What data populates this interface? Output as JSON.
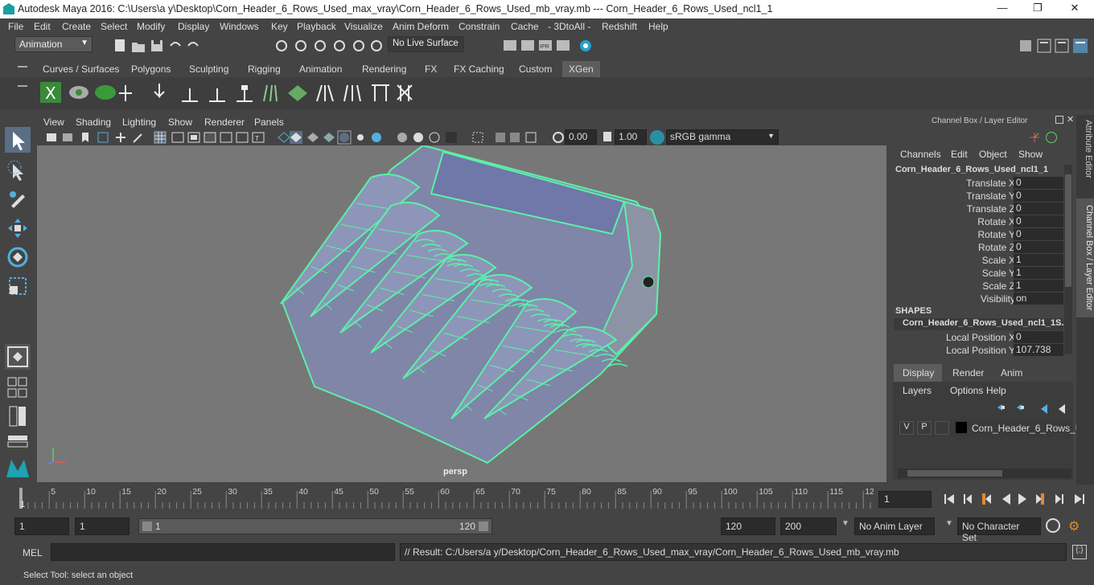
{
  "window": {
    "title": "Autodesk Maya 2016: C:\\Users\\a y\\Desktop\\Corn_Header_6_Rows_Used_max_vray\\Corn_Header_6_Rows_Used_mb_vray.mb   ---   Corn_Header_6_Rows_Used_ncl1_1",
    "minimize": "—",
    "maximize": "❐",
    "close": "✕"
  },
  "menubar": [
    "File",
    "Edit",
    "Create",
    "Select",
    "Modify",
    "Display",
    "Windows",
    "Key",
    "Playback",
    "Visualize",
    "Anim Deform",
    "Constrain",
    "Cache",
    "- 3DtoAll -",
    "Redshift",
    "Help"
  ],
  "statusline": {
    "mode_menu": "Animation",
    "live_surface": "No Live Surface"
  },
  "shelf_tabs": [
    "Curves / Surfaces",
    "Polygons",
    "Sculpting",
    "Rigging",
    "Animation",
    "Rendering",
    "FX",
    "FX Caching",
    "Custom",
    "XGen"
  ],
  "shelf_active_tab": "XGen",
  "viewport": {
    "menus": [
      "View",
      "Shading",
      "Lighting",
      "Show",
      "Renderer",
      "Panels"
    ],
    "exposure": "0.00",
    "gamma": "1.00",
    "color_space": "sRGB gamma",
    "camera_label": "persp",
    "wire_color": "#5cf0a8"
  },
  "channel_box": {
    "title": "Channel Box / Layer Editor",
    "menus": [
      "Channels",
      "Edit",
      "Object",
      "Show"
    ],
    "object_name": "Corn_Header_6_Rows_Used_ncl1_1",
    "attributes": [
      {
        "name": "Translate X",
        "value": "0"
      },
      {
        "name": "Translate Y",
        "value": "0"
      },
      {
        "name": "Translate Z",
        "value": "0"
      },
      {
        "name": "Rotate X",
        "value": "0"
      },
      {
        "name": "Rotate Y",
        "value": "0"
      },
      {
        "name": "Rotate Z",
        "value": "0"
      },
      {
        "name": "Scale X",
        "value": "1"
      },
      {
        "name": "Scale Y",
        "value": "1"
      },
      {
        "name": "Scale Z",
        "value": "1"
      },
      {
        "name": "Visibility",
        "value": "on"
      }
    ],
    "shapes_heading": "SHAPES",
    "shape_name": "Corn_Header_6_Rows_Used_ncl1_1S...",
    "shape_attributes": [
      {
        "name": "Local Position X",
        "value": "0"
      },
      {
        "name": "Local Position Y",
        "value": "107.738"
      }
    ]
  },
  "layer_editor": {
    "tabs": [
      "Display",
      "Render",
      "Anim"
    ],
    "active_tab": "Display",
    "menus": [
      "Layers",
      "Options",
      "Help"
    ],
    "layer": {
      "v": "V",
      "p": "P",
      "name": "Corn_Header_6_Rows_U"
    }
  },
  "side_tabs": [
    "Attribute Editor",
    "Channel Box / Layer Editor"
  ],
  "time_slider": {
    "ticks": [
      "5",
      "10",
      "15",
      "20",
      "25",
      "30",
      "35",
      "40",
      "45",
      "50",
      "55",
      "60",
      "65",
      "70",
      "75",
      "80",
      "85",
      "90",
      "95",
      "100",
      "105",
      "110",
      "115",
      "12"
    ],
    "start_tick": "1",
    "current_frame": "1"
  },
  "range": {
    "start": "1",
    "playback_start": "1",
    "slider_start": "1",
    "slider_end": "120",
    "playback_end": "120",
    "end": "200",
    "anim_layer": "No Anim Layer",
    "character_set": "No Character Set"
  },
  "command": {
    "label": "MEL",
    "result": "// Result: C:/Users/a y/Desktop/Corn_Header_6_Rows_Used_max_vray/Corn_Header_6_Rows_Used_mb_vray.mb"
  },
  "help_line": "Select Tool: select an object"
}
